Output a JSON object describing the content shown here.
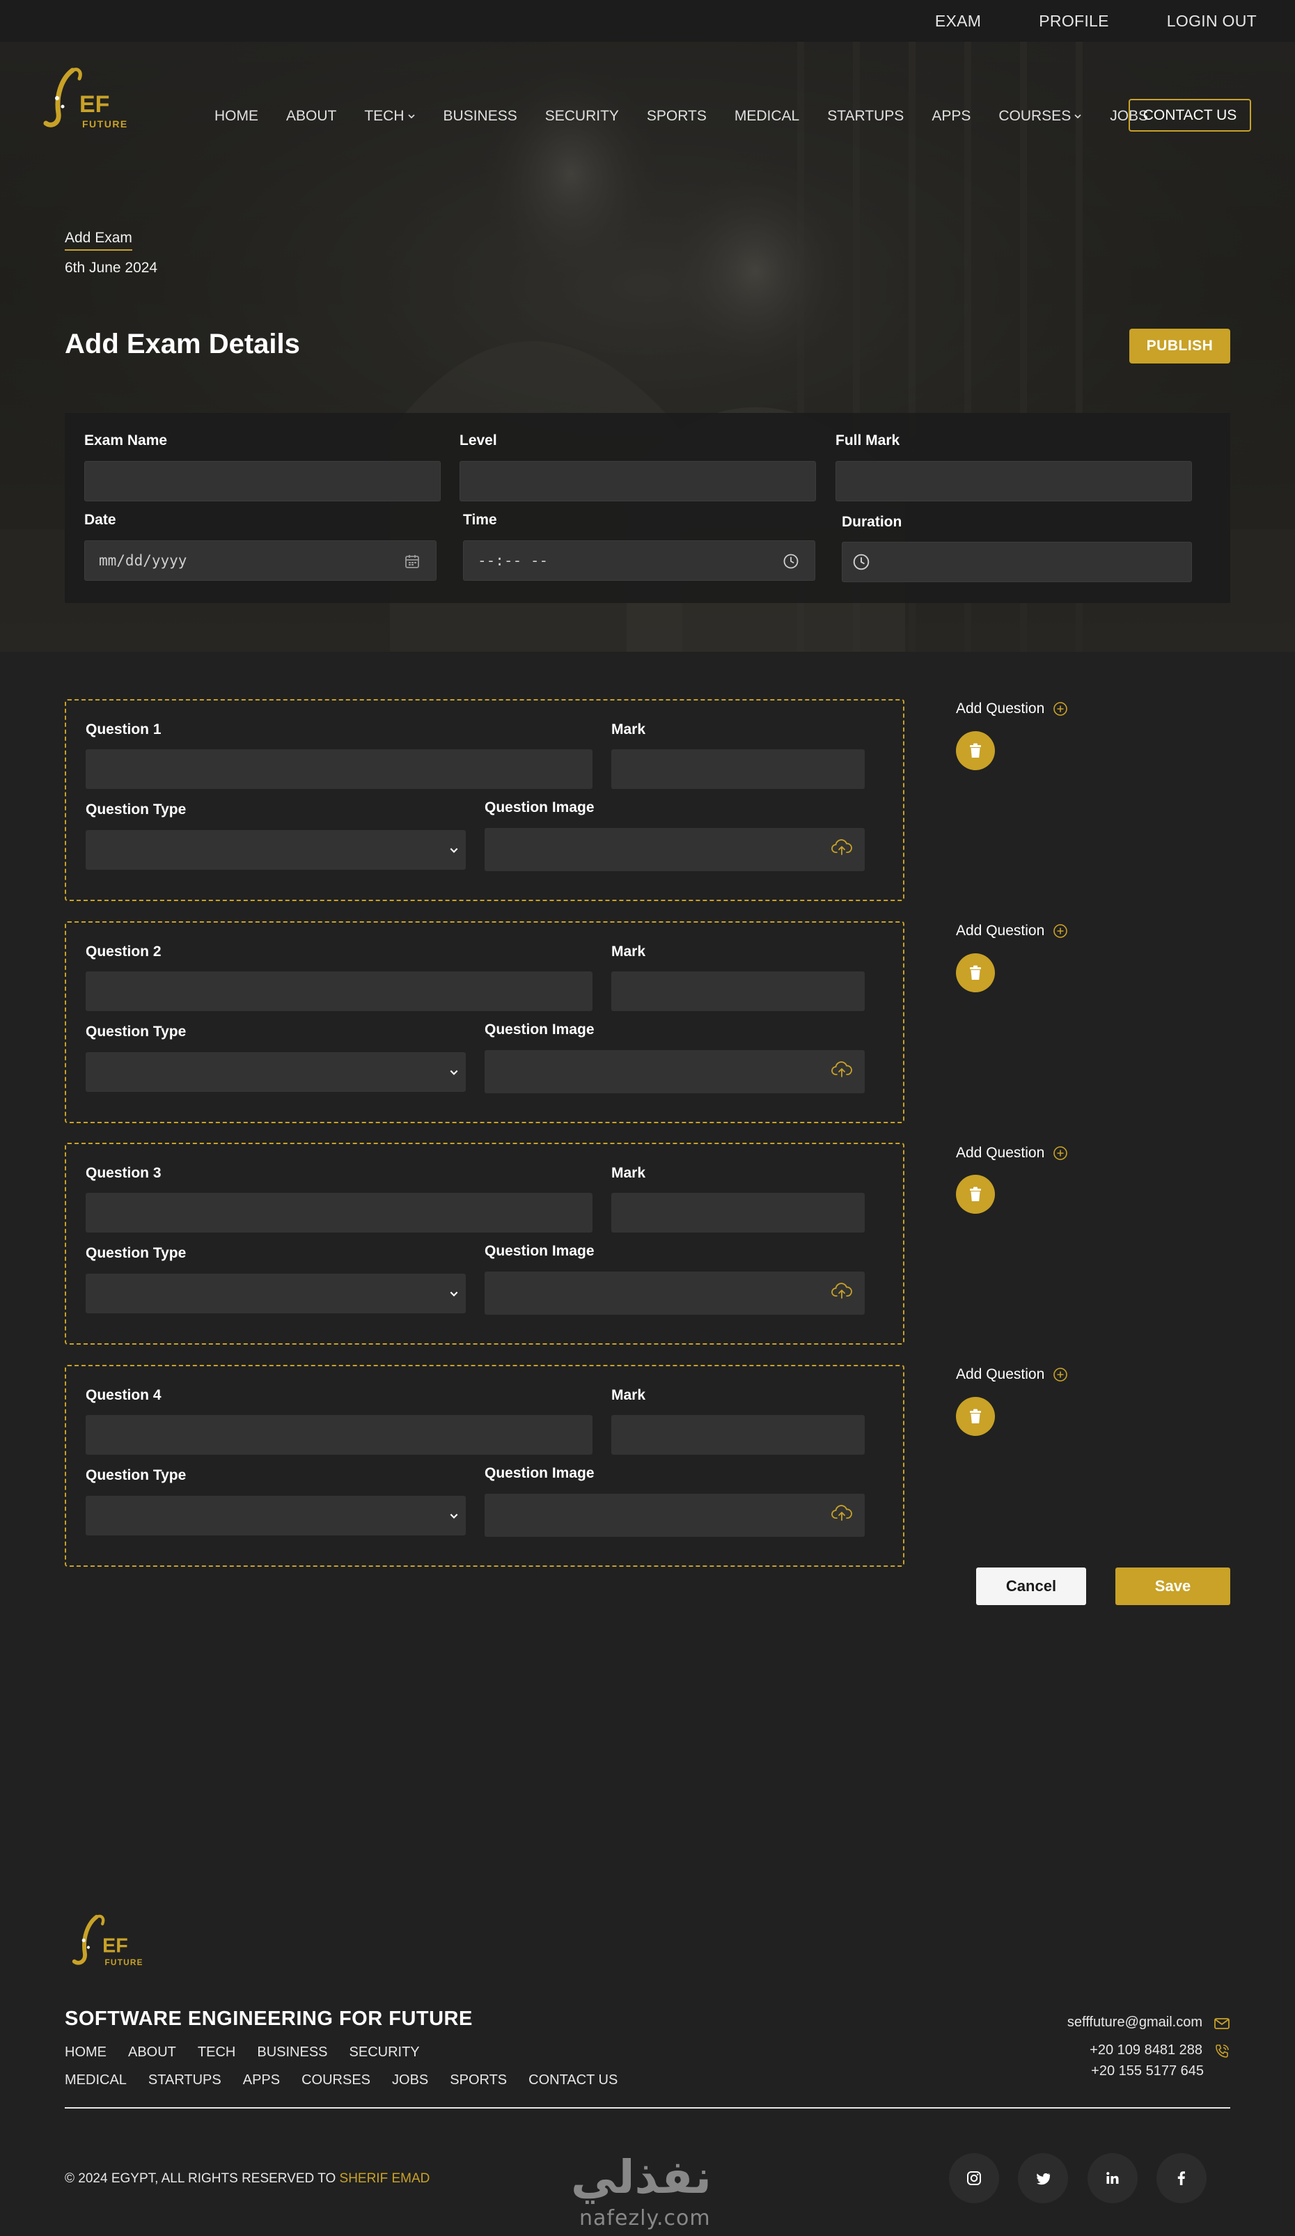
{
  "topbar": {
    "items": [
      "EXAM",
      "PROFILE",
      "LOGIN OUT"
    ]
  },
  "brand": {
    "logo_letters": "EF",
    "logo_sub": "FUTURE",
    "accent_color": "#c9a227"
  },
  "nav": {
    "items": [
      {
        "label": "HOME",
        "dropdown": false
      },
      {
        "label": "ABOUT",
        "dropdown": false
      },
      {
        "label": "TECH",
        "dropdown": true
      },
      {
        "label": "BUSINESS",
        "dropdown": false
      },
      {
        "label": "SECURITY",
        "dropdown": false
      },
      {
        "label": "SPORTS",
        "dropdown": false
      },
      {
        "label": "MEDICAL",
        "dropdown": false
      },
      {
        "label": "STARTUPS",
        "dropdown": false
      },
      {
        "label": "APPS",
        "dropdown": false
      },
      {
        "label": "COURSES",
        "dropdown": true
      },
      {
        "label": "JOBS",
        "dropdown": false
      }
    ],
    "contact_label": "CONTACT US"
  },
  "header": {
    "breadcrumb": "Add Exam",
    "date": "6th June 2024",
    "title": "Add Exam Details",
    "publish_label": "PUBLISH"
  },
  "exam_form": {
    "exam_name_label": "Exam Name",
    "level_label": "Level",
    "full_mark_label": "Full Mark",
    "date_label": "Date",
    "date_placeholder": "mm/dd/yyyy",
    "time_label": "Time",
    "time_placeholder": "--:-- --",
    "duration_label": "Duration"
  },
  "questions": [
    {
      "label": "Question 1",
      "mark_label": "Mark",
      "type_label": "Question Type",
      "image_label": "Question Image"
    },
    {
      "label": "Question 2",
      "mark_label": "Mark",
      "type_label": "Question Type",
      "image_label": "Question Image"
    },
    {
      "label": "Question 3",
      "mark_label": "Mark",
      "type_label": "Question Type",
      "image_label": "Question Image"
    },
    {
      "label": "Question 4",
      "mark_label": "Mark",
      "type_label": "Question Type",
      "image_label": "Question Image"
    }
  ],
  "question_actions": {
    "add_label": "Add Question"
  },
  "form_actions": {
    "cancel_label": "Cancel",
    "save_label": "Save"
  },
  "footer": {
    "title": "SOFTWARE ENGINEERING FOR FUTURE",
    "links_row1": [
      "HOME",
      "ABOUT",
      "TECH",
      "BUSINESS",
      "SECURITY"
    ],
    "links_row2": [
      "MEDICAL",
      "STARTUPS",
      "APPS",
      "COURSES",
      "JOBS",
      "SPORTS",
      "CONTACT US"
    ],
    "email": "sefffuture@gmail.com",
    "phone1": "+20 109 8481 288",
    "phone2": "+20 155 5177 645",
    "copyright_prefix": "© 2024 EGYPT, ALL RIGHTS RESERVED TO ",
    "copyright_author": "SHERIF EMAD",
    "social": [
      "instagram-icon",
      "twitter-icon",
      "linkedin-icon",
      "facebook-icon"
    ]
  },
  "watermark": {
    "arabic": "نفذلي",
    "latin": "nafezly.com"
  }
}
